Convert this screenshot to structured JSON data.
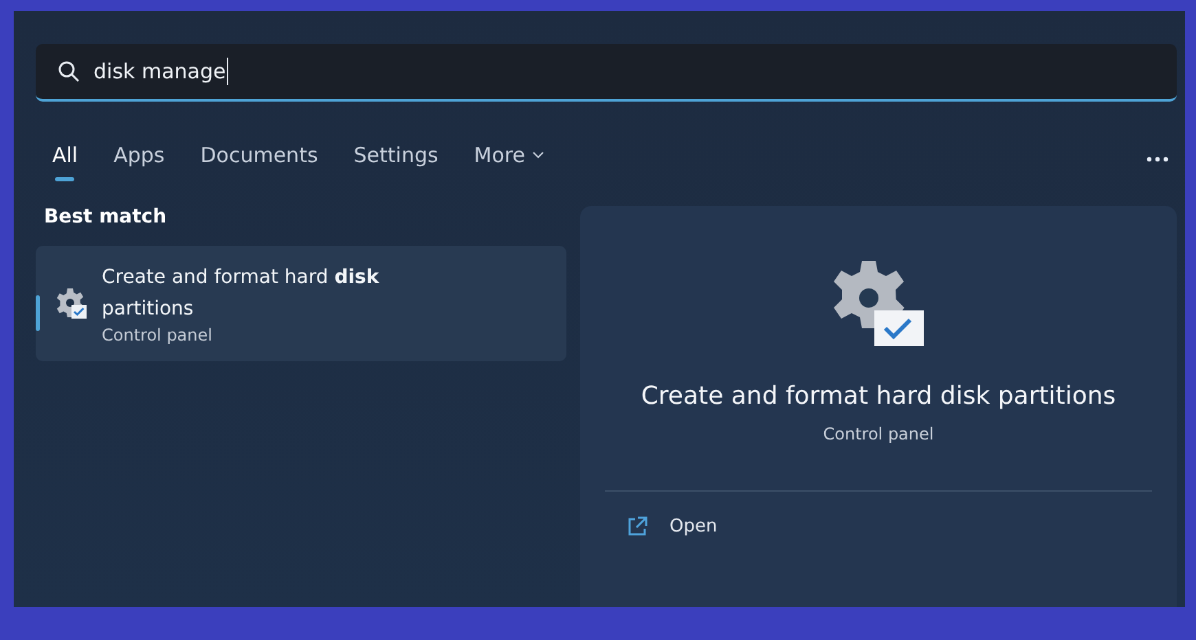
{
  "search": {
    "value": "disk manage"
  },
  "tabs": [
    {
      "label": "All",
      "selected": true,
      "kind": "tab"
    },
    {
      "label": "Apps",
      "selected": false,
      "kind": "tab"
    },
    {
      "label": "Documents",
      "selected": false,
      "kind": "tab"
    },
    {
      "label": "Settings",
      "selected": false,
      "kind": "tab"
    },
    {
      "label": "More",
      "selected": false,
      "kind": "dropdown"
    }
  ],
  "best_match": {
    "heading": "Best match",
    "items": [
      {
        "title": "Create and format hard **disk** partitions",
        "subtitle": "Control panel",
        "selected": true
      }
    ]
  },
  "preview": {
    "title": "Create and format hard disk partitions",
    "subtitle": "Control panel",
    "actions": [
      {
        "label": "Open"
      }
    ]
  }
}
